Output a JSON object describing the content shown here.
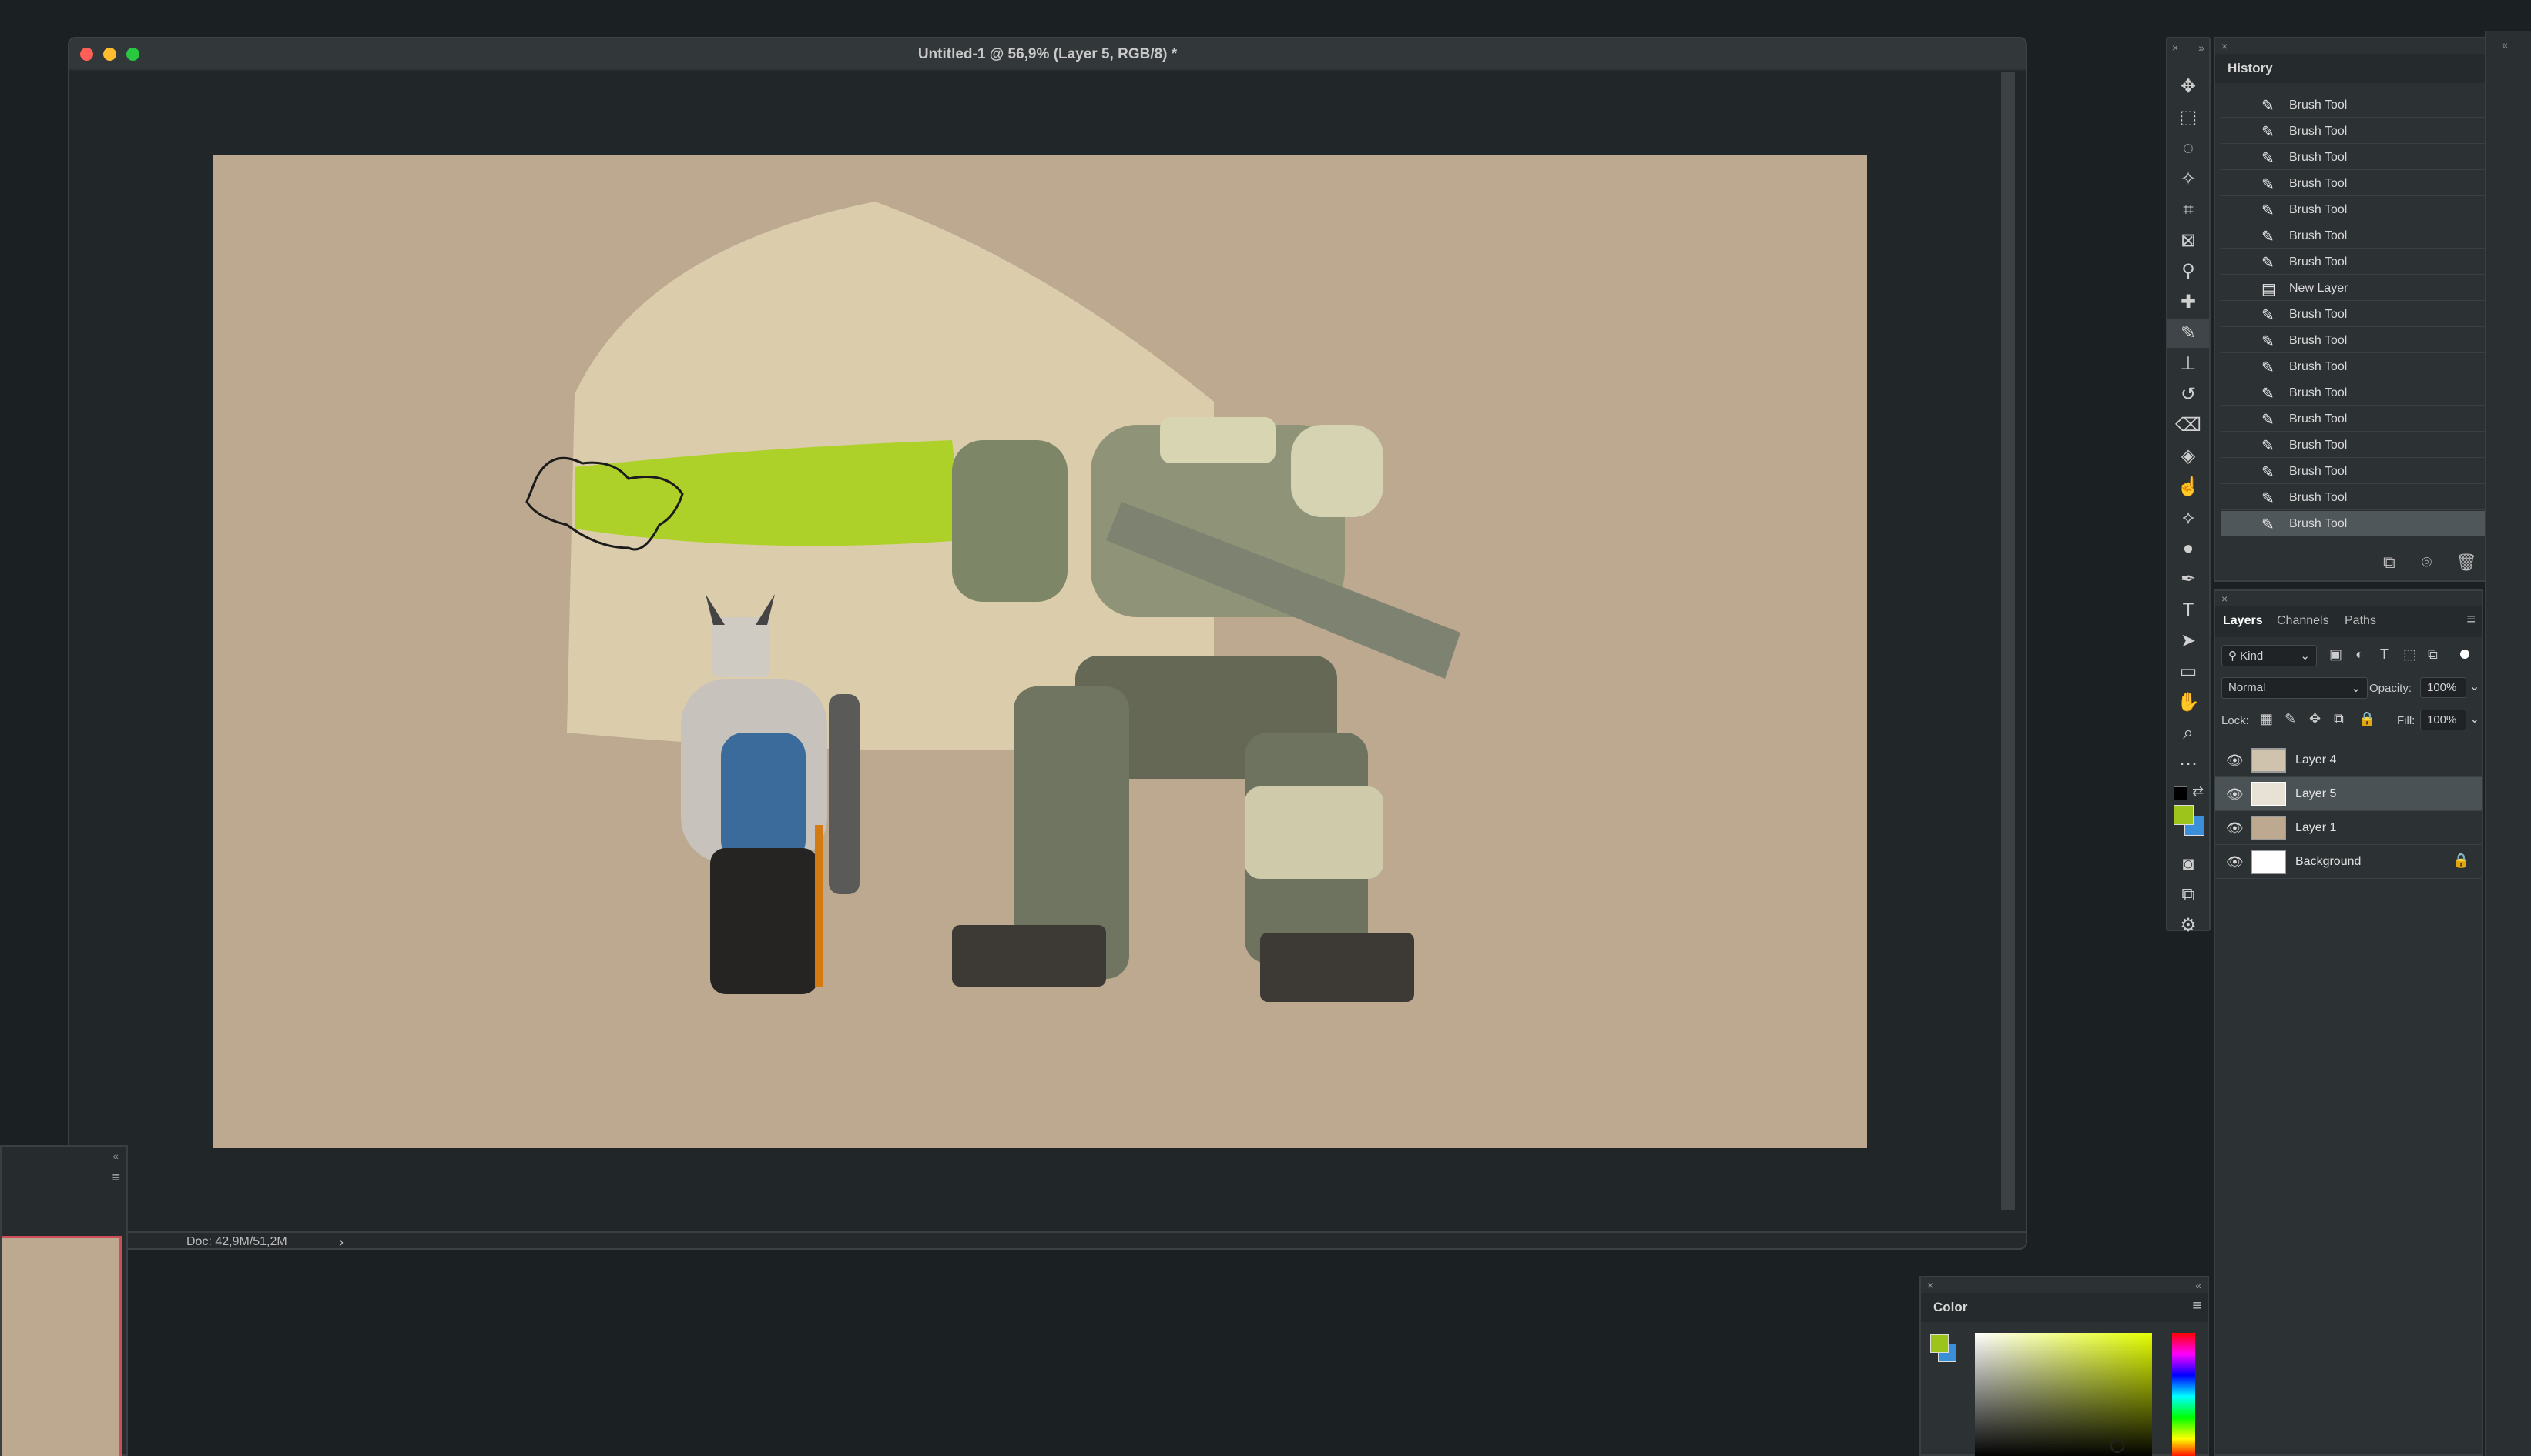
{
  "window": {
    "title": "Untitled-1 @ 56,9% (Layer 5, RGB/8) *",
    "doc_info": "Doc: 42,9M/51,2M"
  },
  "history": {
    "title": "History",
    "items": [
      {
        "label": "Brush Tool",
        "icon": "brush-icon"
      },
      {
        "label": "Brush Tool",
        "icon": "brush-icon"
      },
      {
        "label": "Brush Tool",
        "icon": "brush-icon"
      },
      {
        "label": "Brush Tool",
        "icon": "brush-icon"
      },
      {
        "label": "Brush Tool",
        "icon": "brush-icon"
      },
      {
        "label": "Brush Tool",
        "icon": "brush-icon"
      },
      {
        "label": "Brush Tool",
        "icon": "brush-icon"
      },
      {
        "label": "New Layer",
        "icon": "new-layer-icon"
      },
      {
        "label": "Brush Tool",
        "icon": "brush-icon"
      },
      {
        "label": "Brush Tool",
        "icon": "brush-icon"
      },
      {
        "label": "Brush Tool",
        "icon": "brush-icon"
      },
      {
        "label": "Brush Tool",
        "icon": "brush-icon"
      },
      {
        "label": "Brush Tool",
        "icon": "brush-icon"
      },
      {
        "label": "Brush Tool",
        "icon": "brush-icon"
      },
      {
        "label": "Brush Tool",
        "icon": "brush-icon"
      },
      {
        "label": "Brush Tool",
        "icon": "brush-icon"
      },
      {
        "label": "Brush Tool",
        "icon": "brush-icon",
        "selected": true
      }
    ]
  },
  "layers": {
    "tabs": [
      "Layers",
      "Channels",
      "Paths"
    ],
    "active_tab": "Layers",
    "filter_kind": "Kind",
    "blend_mode": "Normal",
    "opacity_label": "Opacity:",
    "opacity": "100%",
    "lock_label": "Lock:",
    "fill_label": "Fill:",
    "fill": "100%",
    "items": [
      {
        "name": "Layer 4",
        "visible": true,
        "selected": false,
        "locked": false
      },
      {
        "name": "Layer 5",
        "visible": true,
        "selected": true,
        "locked": false
      },
      {
        "name": "Layer 1",
        "visible": true,
        "selected": false,
        "locked": false
      },
      {
        "name": "Background",
        "visible": true,
        "selected": false,
        "locked": true
      }
    ]
  },
  "color_panel": {
    "title": "Color",
    "foreground": "#9dc41a",
    "background": "#3b8fd8"
  },
  "colors": {
    "canvas": "#bda990",
    "accent_green": "#a8d21c",
    "selection_border": "#cc4e57"
  }
}
